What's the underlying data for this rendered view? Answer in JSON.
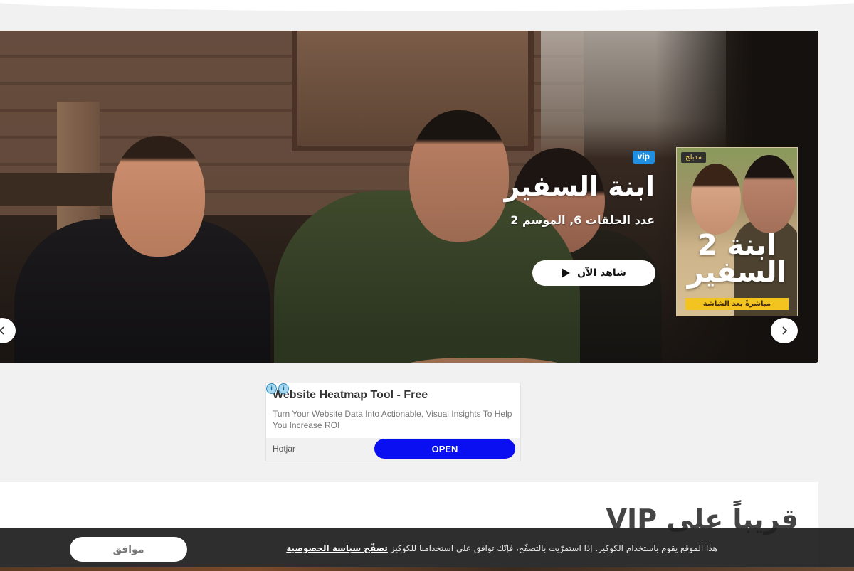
{
  "hero": {
    "badge": "vip",
    "title": "ابنة السفير",
    "meta": "عدد الحلقات 6, الموسم 2",
    "watch_label": "شاهد الآن",
    "poster": {
      "badge": "مدبلج",
      "title_line1": "ابنة 2",
      "title_line2": "السفير",
      "strip": "مباشرةً بعد الشاشة"
    }
  },
  "ad": {
    "title": "Website Heatmap Tool - Free",
    "description": "Turn Your Website Data Into Actionable, Visual Insights To Help You Increase ROI",
    "brand": "Hotjar",
    "cta": "OPEN"
  },
  "section": {
    "title": "قريباً على VIP"
  },
  "cookie": {
    "text": "هذا الموقع يقوم باستخدام الكوكيز. إذا استمرّيت بالتصفّح، فإنّك توافق على استخدامنا للكوكيز",
    "link": "تصفّح سياسة الخصوصية",
    "accept": "موافق"
  },
  "colors": {
    "vip_badge": "#1e8fe3",
    "ad_button": "#0a0ff2",
    "cookie_bar": "#1e1e1e"
  }
}
